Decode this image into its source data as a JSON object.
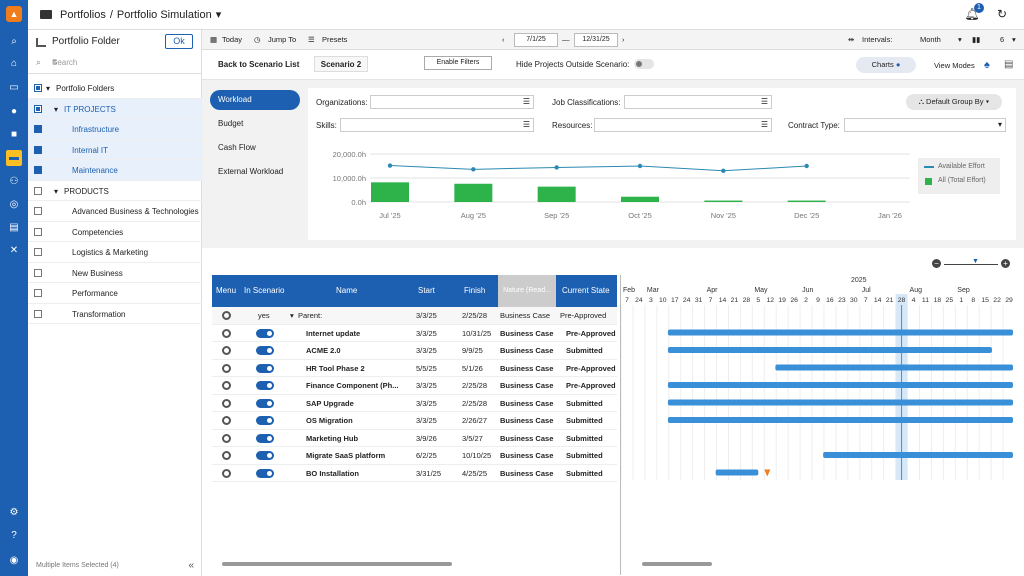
{
  "header": {
    "crumb_root": "Portfolios",
    "crumb_sep": "/",
    "crumb_current": "Portfolio Simulation",
    "notification_count": "1"
  },
  "folder_panel": {
    "title": "Portfolio Folder",
    "ok_label": "Ok",
    "search_placeholder": "Search",
    "footer": "Multiple Items Selected (4)",
    "tree": [
      {
        "label": "Portfolio Folders",
        "level": 0,
        "state": "partial",
        "expand": true,
        "selected": false,
        "blue": false
      },
      {
        "label": "IT PROJECTS",
        "level": 1,
        "state": "partial",
        "expand": true,
        "selected": true,
        "blue": true
      },
      {
        "label": "Infrastructure",
        "level": 2,
        "state": "on",
        "expand": false,
        "selected": true,
        "blue": true
      },
      {
        "label": "Internal IT",
        "level": 2,
        "state": "on",
        "expand": false,
        "selected": true,
        "blue": true
      },
      {
        "label": "Maintenance",
        "level": 2,
        "state": "on",
        "expand": false,
        "selected": true,
        "blue": true
      },
      {
        "label": "PRODUCTS",
        "level": 1,
        "state": "off",
        "expand": true,
        "selected": false,
        "blue": false
      },
      {
        "label": "Advanced Business & Technologies",
        "level": 2,
        "state": "off",
        "expand": false,
        "selected": false,
        "blue": false
      },
      {
        "label": "Competencies",
        "level": 2,
        "state": "off",
        "expand": false,
        "selected": false,
        "blue": false
      },
      {
        "label": "Logistics & Marketing",
        "level": 2,
        "state": "off",
        "expand": false,
        "selected": false,
        "blue": false
      },
      {
        "label": "New Business",
        "level": 2,
        "state": "off",
        "expand": false,
        "selected": false,
        "blue": false
      },
      {
        "label": "Performance",
        "level": 2,
        "state": "off",
        "expand": false,
        "selected": false,
        "blue": false
      },
      {
        "label": "Transformation",
        "level": 2,
        "state": "off",
        "expand": false,
        "selected": false,
        "blue": false
      }
    ]
  },
  "toolbar": {
    "today": "Today",
    "jump_to": "Jump To",
    "presets": "Presets",
    "start_date": "7/1/25",
    "end_date": "12/31/25",
    "intervals_label": "Intervals:",
    "intervals_value": "Month",
    "columns_value": "6"
  },
  "scenario_bar": {
    "back": "Back to Scenario List",
    "scenario": "Scenario 2",
    "enable_filters": "Enable Filters",
    "hide_outside": "Hide Projects Outside Scenario:",
    "charts": "Charts",
    "view_modes": "View Modes"
  },
  "tabs": [
    "Workload",
    "Budget",
    "Cash Flow",
    "External Workload"
  ],
  "filters": {
    "organizations": "Organizations:",
    "job_classifications": "Job Classifications:",
    "skills": "Skills:",
    "resources": "Resources:",
    "contract_type": "Contract Type:",
    "group_by": "Default Group By"
  },
  "chart_data": {
    "type": "bar",
    "categories": [
      "Jul '25",
      "Aug '25",
      "Sep '25",
      "Oct '25",
      "Nov '25",
      "Dec '25",
      "Jan '26"
    ],
    "y_ticks": [
      "20,000.0h",
      "10,000.0h",
      "0.0h"
    ],
    "ylim": [
      0,
      20000
    ],
    "series": [
      {
        "name": "Available Effort",
        "type": "line",
        "color": "#2a8ab3",
        "values": [
          15200,
          13600,
          14400,
          15000,
          13000,
          15000,
          null
        ]
      },
      {
        "name": "All (Total Effort)",
        "type": "bar",
        "color": "#2db34a",
        "values": [
          8200,
          7600,
          6400,
          2200,
          600,
          600,
          null
        ]
      }
    ]
  },
  "table": {
    "columns": [
      "Menu",
      "In Scenario",
      "Name",
      "Start",
      "Finish",
      "Nature (Read...",
      "Current State"
    ],
    "parent": {
      "in_scenario": "yes",
      "name": "Parent:",
      "start": "3/3/25",
      "finish": "2/25/28",
      "nature": "Business Case",
      "state": "Pre-Approved"
    },
    "rows": [
      {
        "name": "Internet update",
        "start": "3/3/25",
        "finish": "10/31/25",
        "nature": "Business Case",
        "state": "Pre-Approved"
      },
      {
        "name": "ACME 2.0",
        "start": "3/3/25",
        "finish": "9/9/25",
        "nature": "Business Case",
        "state": "Submitted"
      },
      {
        "name": "HR Tool Phase 2",
        "start": "5/5/25",
        "finish": "5/1/26",
        "nature": "Business Case",
        "state": "Pre-Approved"
      },
      {
        "name": "Finance Component (Ph...",
        "start": "3/3/25",
        "finish": "2/25/28",
        "nature": "Business Case",
        "state": "Pre-Approved"
      },
      {
        "name": "SAP Upgrade",
        "start": "3/3/25",
        "finish": "2/25/28",
        "nature": "Business Case",
        "state": "Submitted"
      },
      {
        "name": "OS Migration",
        "start": "3/3/25",
        "finish": "2/26/27",
        "nature": "Business Case",
        "state": "Submitted"
      },
      {
        "name": "Marketing Hub",
        "start": "3/9/26",
        "finish": "3/5/27",
        "nature": "Business Case",
        "state": "Submitted"
      },
      {
        "name": "Migrate SaaS platform",
        "start": "6/2/25",
        "finish": "10/10/25",
        "nature": "Business Case",
        "state": "Submitted"
      },
      {
        "name": "BO Installation",
        "start": "3/31/25",
        "finish": "4/25/25",
        "nature": "Business Case",
        "state": "Submitted"
      }
    ]
  },
  "gantt": {
    "year": "2025",
    "months": [
      "Feb",
      "Mar",
      "Apr",
      "May",
      "Jun",
      "Jul",
      "Aug",
      "Sep"
    ],
    "days": [
      "7",
      "24",
      "3",
      "10",
      "17",
      "24",
      "31",
      "7",
      "14",
      "21",
      "28",
      "5",
      "12",
      "19",
      "26",
      "2",
      "9",
      "16",
      "23",
      "30",
      "7",
      "14",
      "21",
      "28",
      "4",
      "11",
      "18",
      "25",
      "1",
      "8",
      "15",
      "22",
      "29"
    ],
    "highlight_day": "28"
  }
}
